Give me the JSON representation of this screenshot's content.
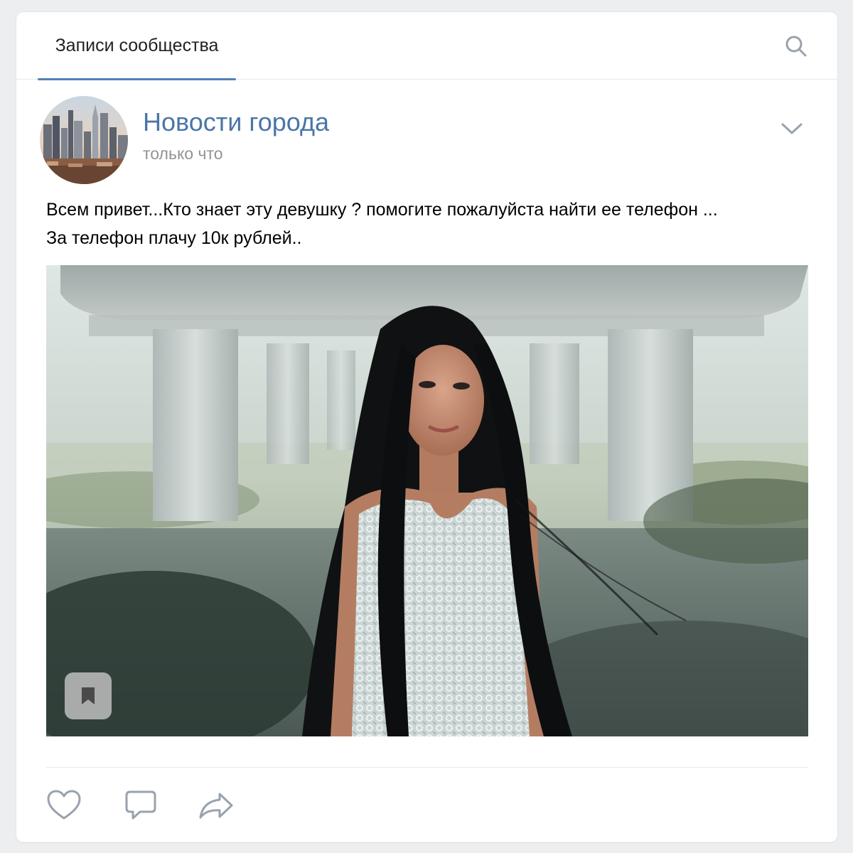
{
  "tabs": {
    "active_label": "Записи сообщества"
  },
  "icons": {
    "search": "search-icon",
    "menu": "chevron-down-icon",
    "bookmark": "bookmark-icon",
    "like": "heart-icon",
    "comment": "comment-icon",
    "share": "share-arrow-icon"
  },
  "post": {
    "author": "Новости города",
    "time": "только что",
    "text_line1": "Всем привет...Кто знает эту девушку ? помогите пожалуйста найти ее телефон ...",
    "text_line2": "За телефон плачу 10к рублей.."
  },
  "colors": {
    "accent": "#5181b8",
    "link": "#4a76a8",
    "secondary_text": "#939393",
    "icon": "#99a2ad"
  }
}
